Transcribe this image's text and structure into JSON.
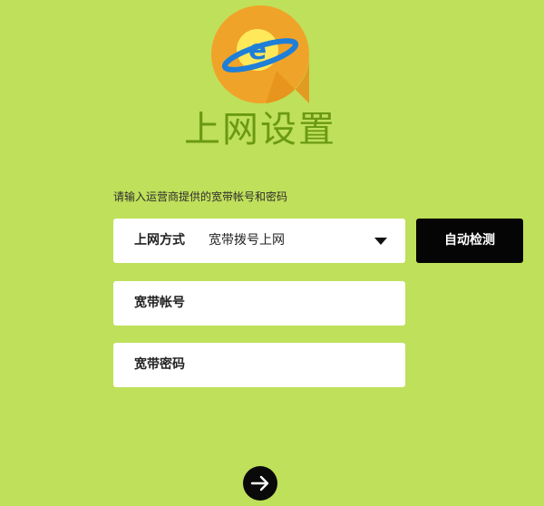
{
  "page": {
    "title": "上网设置",
    "hint": "请输入运营商提供的宽带帐号和密码"
  },
  "connection": {
    "label": "上网方式",
    "selected": "宽带拨号上网"
  },
  "account": {
    "label": "宽带帐号",
    "value": ""
  },
  "password": {
    "label": "宽带密码",
    "value": ""
  },
  "buttons": {
    "detect": "自动检测"
  },
  "icons": {
    "logo": "ie-globe-logo-icon",
    "dropdown": "chevron-down-icon",
    "next": "arrow-right-icon"
  },
  "colors": {
    "background": "#bfe05a",
    "title": "#6b9a12",
    "logo_circle": "#f0a329",
    "logo_ring": "#1f7fd8",
    "button": "#050505"
  }
}
